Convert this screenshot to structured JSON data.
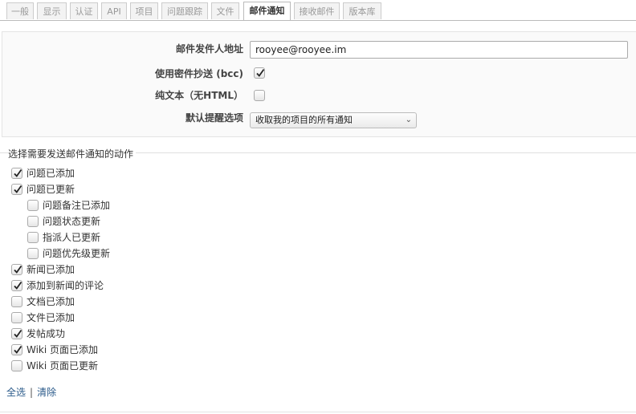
{
  "tabs": [
    "一般",
    "显示",
    "认证",
    "API",
    "项目",
    "问题跟踪",
    "文件",
    "邮件通知",
    "接收邮件",
    "版本库"
  ],
  "active_tab": "邮件通知",
  "settings": {
    "sender_label": "邮件发件人地址",
    "sender_value": "rooyee@rooyee.im",
    "bcc_label": "使用密件抄送 (bcc)",
    "bcc_checked": true,
    "plain_label": "纯文本（无HTML）",
    "plain_checked": false,
    "default_label": "默认提醒选项",
    "default_value": "收取我的项目的所有通知"
  },
  "actions": {
    "legend": "选择需要发送邮件通知的动作",
    "items": [
      {
        "label": "问题已添加",
        "checked": true,
        "indent": false
      },
      {
        "label": "问题已更新",
        "checked": true,
        "indent": false
      },
      {
        "label": "问题备注已添加",
        "checked": false,
        "indent": true
      },
      {
        "label": "问题状态更新",
        "checked": false,
        "indent": true
      },
      {
        "label": "指派人已更新",
        "checked": false,
        "indent": true
      },
      {
        "label": "问题优先级更新",
        "checked": false,
        "indent": true
      },
      {
        "label": "新闻已添加",
        "checked": true,
        "indent": false
      },
      {
        "label": "添加到新闻的评论",
        "checked": true,
        "indent": false
      },
      {
        "label": "文档已添加",
        "checked": false,
        "indent": false
      },
      {
        "label": "文件已添加",
        "checked": false,
        "indent": false
      },
      {
        "label": "发帖成功",
        "checked": true,
        "indent": false
      },
      {
        "label": "Wiki 页面已添加",
        "checked": true,
        "indent": false
      },
      {
        "label": "Wiki 页面已更新",
        "checked": false,
        "indent": false
      }
    ],
    "select_all": "全选",
    "separator": "|",
    "clear": "清除"
  }
}
